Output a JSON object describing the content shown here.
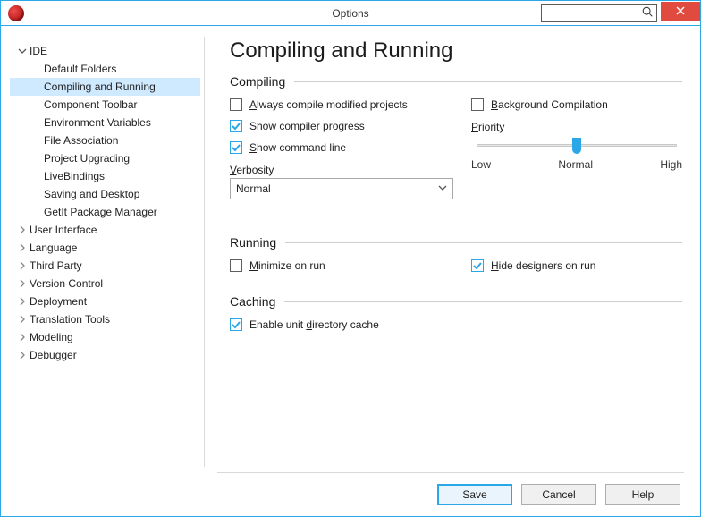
{
  "window": {
    "title": "Options"
  },
  "tree": {
    "top": [
      {
        "label": "IDE",
        "expanded": true,
        "children": [
          "Default Folders",
          "Compiling and Running",
          "Component Toolbar",
          "Environment Variables",
          "File Association",
          "Project Upgrading",
          "LiveBindings",
          "Saving and Desktop",
          "GetIt Package Manager"
        ]
      },
      {
        "label": "User Interface",
        "expanded": false
      },
      {
        "label": "Language",
        "expanded": false
      },
      {
        "label": "Third Party",
        "expanded": false
      },
      {
        "label": "Version Control",
        "expanded": false
      },
      {
        "label": "Deployment",
        "expanded": false
      },
      {
        "label": "Translation Tools",
        "expanded": false
      },
      {
        "label": "Modeling",
        "expanded": false
      },
      {
        "label": "Debugger",
        "expanded": false
      }
    ],
    "selected": "Compiling and Running"
  },
  "page": {
    "title": "Compiling and Running",
    "sections": {
      "compiling": {
        "title": "Compiling",
        "always_compile_label": "Always compile modified projects",
        "always_compile_checked": false,
        "show_progress_label": "Show compiler progress",
        "show_progress_checked": true,
        "show_cmdline_label": "Show command line",
        "show_cmdline_checked": true,
        "background_compile_label": "Background Compilation",
        "background_compile_checked": false,
        "priority_label": "Priority",
        "slider": {
          "low": "Low",
          "mid": "Normal",
          "high": "High",
          "value": "Normal"
        },
        "verbosity_label": "Verbosity",
        "verbosity_value": "Normal"
      },
      "running": {
        "title": "Running",
        "minimize_label": "Minimize on run",
        "minimize_checked": false,
        "hide_designers_label": "Hide designers on run",
        "hide_designers_checked": true
      },
      "caching": {
        "title": "Caching",
        "enable_cache_label": "Enable unit directory cache",
        "enable_cache_checked": true
      }
    }
  },
  "buttons": {
    "save": "Save",
    "cancel": "Cancel",
    "help": "Help"
  }
}
